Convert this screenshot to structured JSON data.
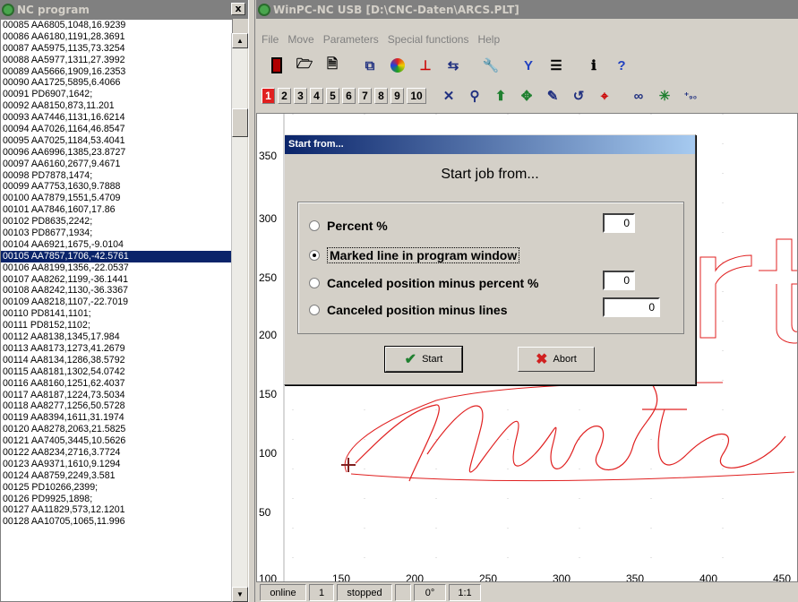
{
  "nc_panel": {
    "title": "NC program",
    "close_label": "x",
    "lines": [
      "00085 AA6805,1048,16.9239",
      "00086 AA6180,1191,28.3691",
      "00087 AA5975,1135,73.3254",
      "00088 AA5977,1311,27.3992",
      "00089 AA5666,1909,16.2353",
      "00090 AA1725,5895,6.4066",
      "00091 PD6907,1642;",
      "00092 AA8150,873,11.201",
      "00093 AA7446,1131,16.6214",
      "00094 AA7026,1164,46.8547",
      "00095 AA7025,1184,53.4041",
      "00096 AA6996,1385,23.8727",
      "00097 AA6160,2677,9.4671",
      "00098 PD7878,1474;",
      "00099 AA7753,1630,9.7888",
      "00100 AA7879,1551,5.4709",
      "00101 AA7846,1607,17.86",
      "00102 PD8635,2242;",
      "00103 PD8677,1934;",
      "00104 AA6921,1675,-9.0104",
      "00105 AA7857,1706,-42.5761",
      "00106 AA8199,1356,-22.0537",
      "00107 AA8262,1199,-36.1441",
      "00108 AA8242,1130,-36.3367",
      "00109 AA8218,1107,-22.7019",
      "00110 PD8141,1101;",
      "00111 PD8152,1102;",
      "00112 AA8138,1345,17.984",
      "00113 AA8173,1273,41.2679",
      "00114 AA8134,1286,38.5792",
      "00115 AA8181,1302,54.0742",
      "00116 AA8160,1251,62.4037",
      "00117 AA8187,1224,73.5034",
      "00118 AA8277,1256,50.5728",
      "00119 AA8394,1611,31.1974",
      "00120 AA8278,2063,21.5825",
      "00121 AA7405,3445,10.5626",
      "00122 AA8234,2716,3.7724",
      "00123 AA9371,1610,9.1294",
      "00124 AA8759,2249,3.581",
      "00125 PD10266,2399;",
      "00126 PD9925,1898;",
      "00127 AA11829,573,12.1201",
      "00128 AA10705,1065,11.996"
    ],
    "selected_index": 20
  },
  "main": {
    "title": "WinPC-NC USB [D:\\CNC-Daten\\ARCS.PLT]",
    "menu": [
      "File",
      "Move",
      "Parameters",
      "Special functions",
      "Help"
    ],
    "toolbar1_icons": [
      "stop-icon",
      "open-folder-icon",
      "file-icon",
      "zoom-area-icon",
      "color-wheel-icon",
      "toolchange-icon",
      "path-icon",
      "tool-icon",
      "magnet-icon",
      "list-icon",
      "info-icon",
      "help-icon"
    ],
    "toolbar2_numbers": [
      "1",
      "2",
      "3",
      "4",
      "5",
      "6",
      "7",
      "8",
      "9",
      "10"
    ],
    "toolbar2_icons": [
      "cross-icon",
      "search-icon",
      "up-arrow-icon",
      "move-icon",
      "pen-icon",
      "rotate-icon",
      "target-icon",
      "glasses-icon",
      "star-icon",
      "rotate-90-icon"
    ],
    "y_ticks": [
      "350",
      "300",
      "250",
      "200",
      "150",
      "100",
      "50"
    ],
    "x_ticks": [
      "100",
      "150",
      "200",
      "250",
      "300",
      "350",
      "400",
      "450"
    ],
    "canvas_text_large": "rto",
    "canvas_text_script": "Muster",
    "status": [
      "online",
      "1",
      "stopped",
      "",
      "0°",
      "1:1"
    ]
  },
  "dialog": {
    "title": "Start from...",
    "heading": "Start job from...",
    "options": [
      {
        "label": "Percent %",
        "selected": false,
        "value": "0"
      },
      {
        "label": "Marked line in program window",
        "selected": true,
        "value": null
      },
      {
        "label": "Canceled position minus percent %",
        "selected": false,
        "value": "0"
      },
      {
        "label": "Canceled position minus lines",
        "selected": false,
        "value": "0"
      }
    ],
    "start_label": "Start",
    "abort_label": "Abort"
  },
  "colors": {
    "selection": "#0a246a",
    "drawing": "#e02020",
    "dialog_title": "#0a246a"
  }
}
